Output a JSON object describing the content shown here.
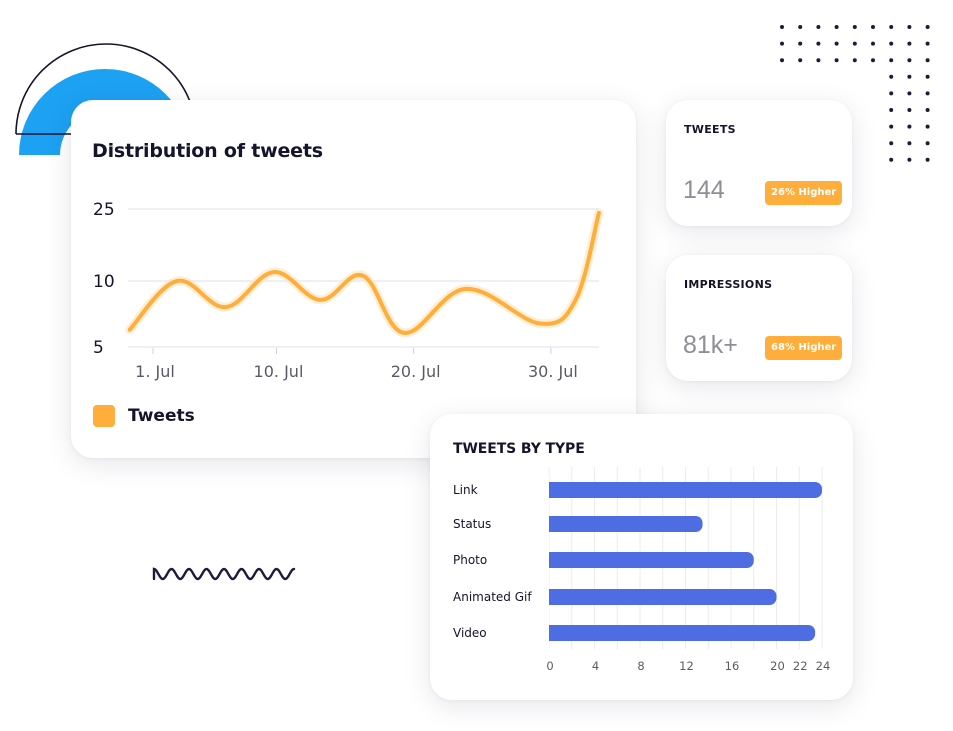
{
  "colors": {
    "accent_orange": "#ffad3b",
    "bar_blue": "#4e6de3",
    "deco_blue": "#1da1f2",
    "deco_dark": "#1c1b3a",
    "grid": "#e6e8ee",
    "text_dark": "#14142b",
    "text_muted": "#5a5a66"
  },
  "distribution": {
    "title": "Distribution of tweets",
    "legend_label": "Tweets"
  },
  "stats": {
    "tweets": {
      "label": "TWEETS",
      "value": "144",
      "badge": "26% Higher"
    },
    "impressions": {
      "label": "IMPRESSIONS",
      "value": "81k+",
      "badge": "68% Higher"
    }
  },
  "tweets_by_type": {
    "title": "TWEETS BY TYPE"
  },
  "decorations": {
    "semicircle": "blue-semicircle",
    "dot_grid": "dot-grid",
    "wave": "squiggle-line"
  },
  "chart_data": [
    {
      "type": "line",
      "title": "Distribution of tweets",
      "xlabel": "",
      "ylabel": "",
      "x_tick_labels": [
        "1. Jul",
        "10. Jul",
        "20. Jul",
        "30. Jul"
      ],
      "x_tick_days": [
        1,
        10,
        20,
        30
      ],
      "y_ticks": [
        5,
        10,
        25
      ],
      "y_scale": "log",
      "grid": true,
      "legend": "bottom-left",
      "series": [
        {
          "name": "Tweets",
          "x_days": [
            -0.7,
            2.75,
            6.3,
            9.8,
            13.2,
            16.3,
            19.3,
            23.8,
            29.2,
            31.8,
            33.5
          ],
          "values": [
            6.0,
            10.0,
            7.6,
            11.2,
            8.2,
            10.7,
            5.8,
            9.2,
            6.4,
            8.2,
            23.8
          ]
        }
      ]
    },
    {
      "type": "bar",
      "orientation": "horizontal",
      "title": "TWEETS BY TYPE",
      "categories": [
        "Link",
        "Status",
        "Photo",
        "Animated Gif",
        "Video"
      ],
      "values": [
        24,
        13.5,
        18,
        20,
        23.4
      ],
      "x_tick_labels": [
        "0",
        "4",
        "8",
        "12",
        "16",
        "20",
        "22",
        "24"
      ],
      "xlim": [
        0,
        24
      ],
      "grid": true
    }
  ]
}
